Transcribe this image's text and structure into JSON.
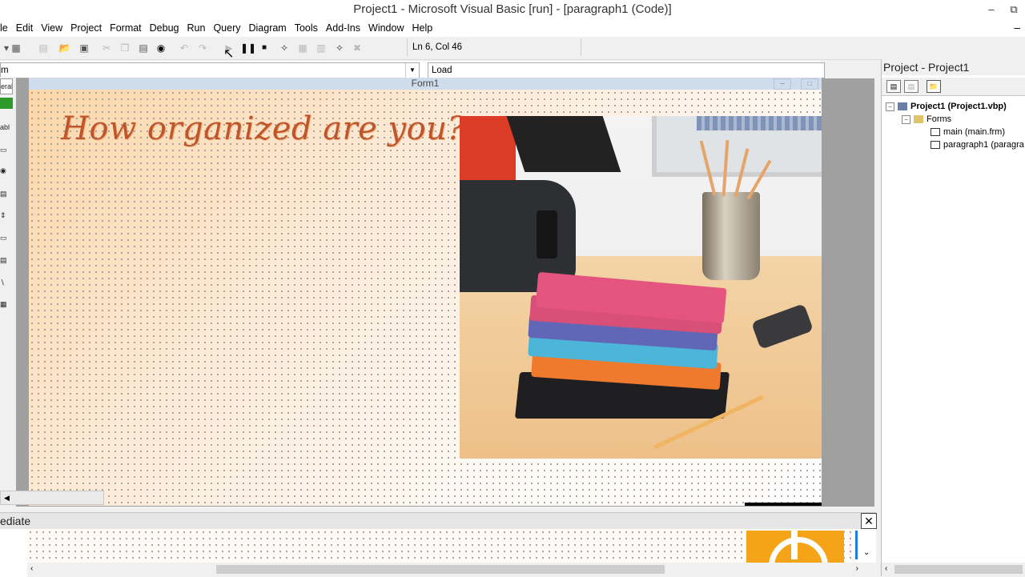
{
  "window": {
    "title": "Project1 - Microsoft Visual Basic [run] - [paragraph1 (Code)]",
    "minimize": "–",
    "restore": "⧉"
  },
  "menu": [
    "le",
    "Edit",
    "View",
    "Project",
    "Format",
    "Debug",
    "Run",
    "Query",
    "Diagram",
    "Tools",
    "Add-Ins",
    "Window",
    "Help"
  ],
  "menu_extra": "–",
  "toolbar": {
    "status": "Ln 6, Col 46",
    "icons": [
      "add-project-icon",
      "add-form-icon",
      "menu-editor-icon",
      "open-icon",
      "save-icon",
      "cut-icon",
      "copy-icon",
      "paste-icon",
      "find-icon",
      "undo-icon",
      "redo-icon",
      "start-icon",
      "break-icon",
      "end-icon",
      "project-explorer-icon",
      "properties-icon",
      "form-layout-icon",
      "object-browser-icon",
      "toolbox-icon"
    ]
  },
  "code": {
    "object_combo": "m",
    "procedure_combo": "Load"
  },
  "toolbox": {
    "items": [
      "eral",
      "",
      "abl",
      "",
      "",
      "",
      "",
      "",
      "",
      "",
      ""
    ]
  },
  "form": {
    "caption": "Form1",
    "headline": "How organized are you?"
  },
  "immediate": {
    "title": "ediate",
    "close": "✕"
  },
  "project": {
    "title": "Project - Project1",
    "root": "Project1 (Project1.vbp)",
    "folder": "Forms",
    "items": [
      "main (main.frm)",
      "paragraph1 (paragra"
    ]
  },
  "colors": {
    "headline": "#c0552a",
    "form_title": "#cfdcec",
    "logo": "#f5a418"
  }
}
